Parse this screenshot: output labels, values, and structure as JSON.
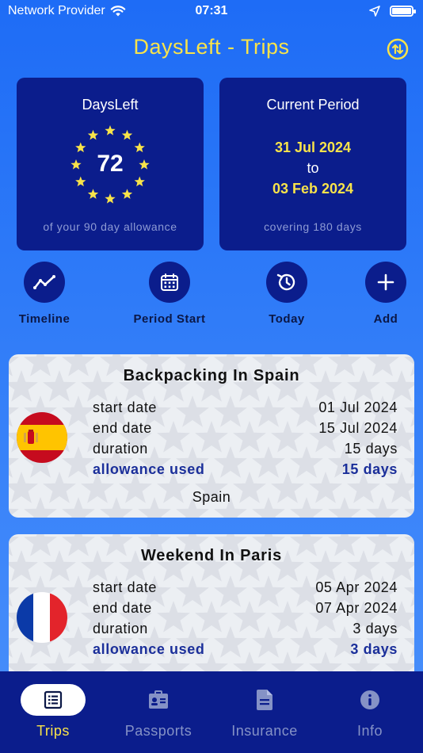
{
  "status": {
    "carrier": "Network Provider",
    "time": "07:31"
  },
  "header": {
    "title": "DaysLeft - Trips"
  },
  "days_panel": {
    "title": "DaysLeft",
    "value": "72",
    "footer": "of your 90 day allowance"
  },
  "period_panel": {
    "title": "Current Period",
    "start": "31 Jul 2024",
    "to": "to",
    "end": "03 Feb 2024",
    "footer": "covering 180 days"
  },
  "actions": [
    {
      "label": "Timeline",
      "icon": "timeline-icon"
    },
    {
      "label": "Period Start",
      "icon": "calendar-icon"
    },
    {
      "label": "Today",
      "icon": "history-icon"
    },
    {
      "label": "Add",
      "icon": "plus-icon"
    }
  ],
  "trips": [
    {
      "title": "Backpacking In Spain",
      "flag": "spain-flag-icon",
      "start_label": "start date",
      "start": "01 Jul 2024",
      "end_label": "end date",
      "end": "15 Jul 2024",
      "duration_label": "duration",
      "duration": "15 days",
      "allowance_label": "allowance used",
      "allowance": "15 days",
      "country": "Spain"
    },
    {
      "title": "Weekend In Paris",
      "flag": "france-flag-icon",
      "start_label": "start date",
      "start": "05 Apr 2024",
      "end_label": "end date",
      "end": "07 Apr 2024",
      "duration_label": "duration",
      "duration": "3 days",
      "allowance_label": "allowance used",
      "allowance": "3 days"
    }
  ],
  "tabs": [
    {
      "label": "Trips",
      "icon": "trips-list-icon",
      "active": true
    },
    {
      "label": "Passports",
      "icon": "passport-icon",
      "active": false
    },
    {
      "label": "Insurance",
      "icon": "document-icon",
      "active": false
    },
    {
      "label": "Info",
      "icon": "info-icon",
      "active": false
    }
  ],
  "colors": {
    "accent": "#f8e34a",
    "navy": "#0b1d8c",
    "strong_text": "#1b2f9a"
  }
}
